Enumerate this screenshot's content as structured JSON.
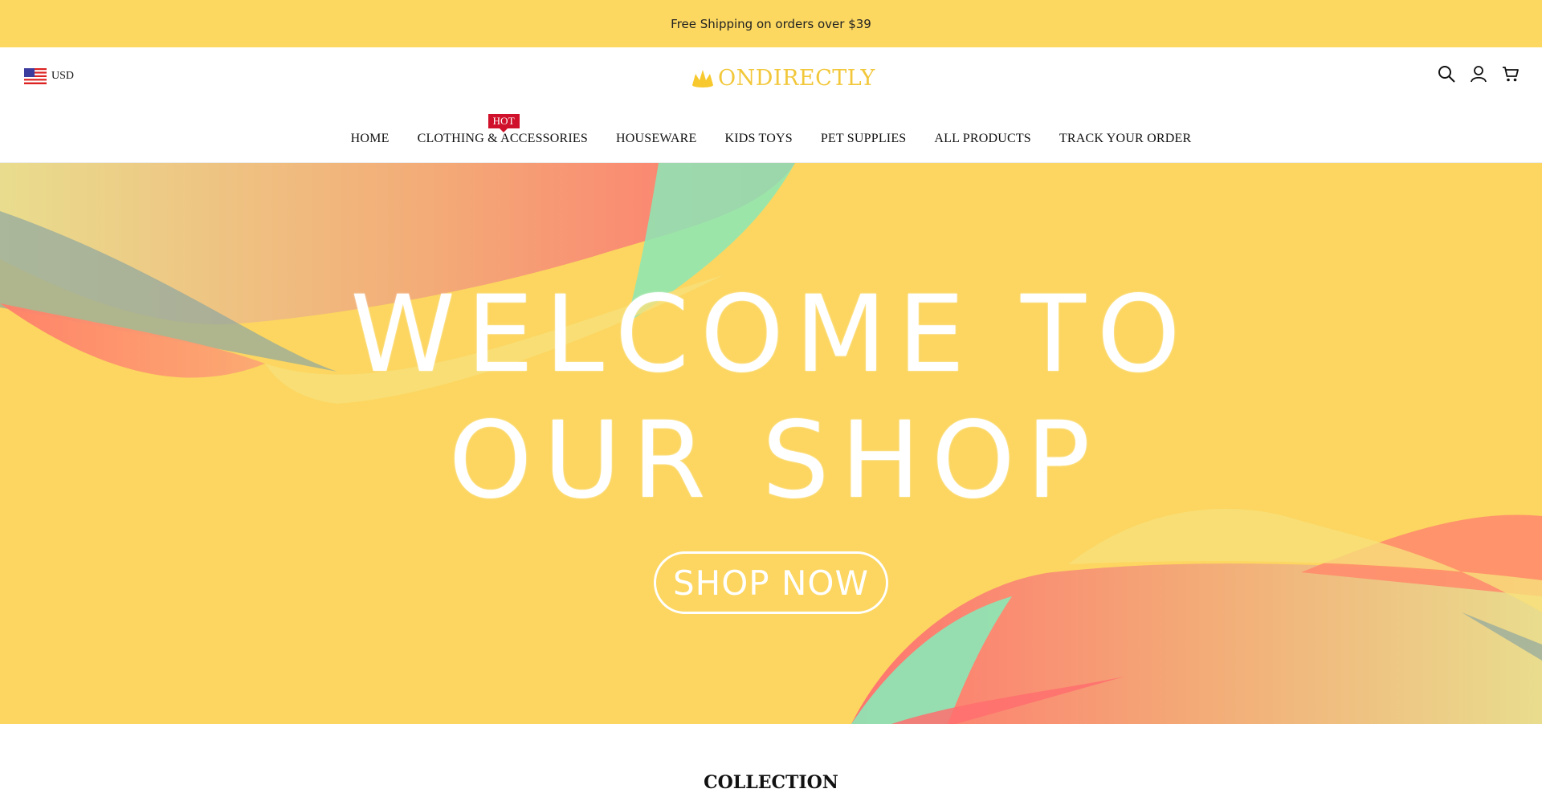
{
  "announcement": {
    "text": "Free Shipping on orders over $39"
  },
  "header": {
    "currency": {
      "code": "USD",
      "flag_icon": "us-flag-icon"
    },
    "logo": {
      "text": "ONDIRECTLY",
      "color": "#f2c73a"
    },
    "icons": [
      "search-icon",
      "account-icon",
      "cart-icon"
    ]
  },
  "nav": {
    "items": [
      {
        "label": "HOME"
      },
      {
        "label": "CLOTHING & ACCESSORIES",
        "badge": "HOT"
      },
      {
        "label": "HOUSEWARE"
      },
      {
        "label": "KIDS TOYS"
      },
      {
        "label": "PET SUPPLIES"
      },
      {
        "label": "ALL PRODUCTS"
      },
      {
        "label": "TRACK YOUR ORDER"
      }
    ]
  },
  "hero": {
    "line1": "WELCOME TO",
    "line2": "OUR  SHOP",
    "button": "SHOP NOW",
    "background": "#fcd660"
  },
  "section": {
    "title": "COLLECTION"
  },
  "colors": {
    "announcement_bg": "#fcd860",
    "badge": "#d0112b"
  }
}
